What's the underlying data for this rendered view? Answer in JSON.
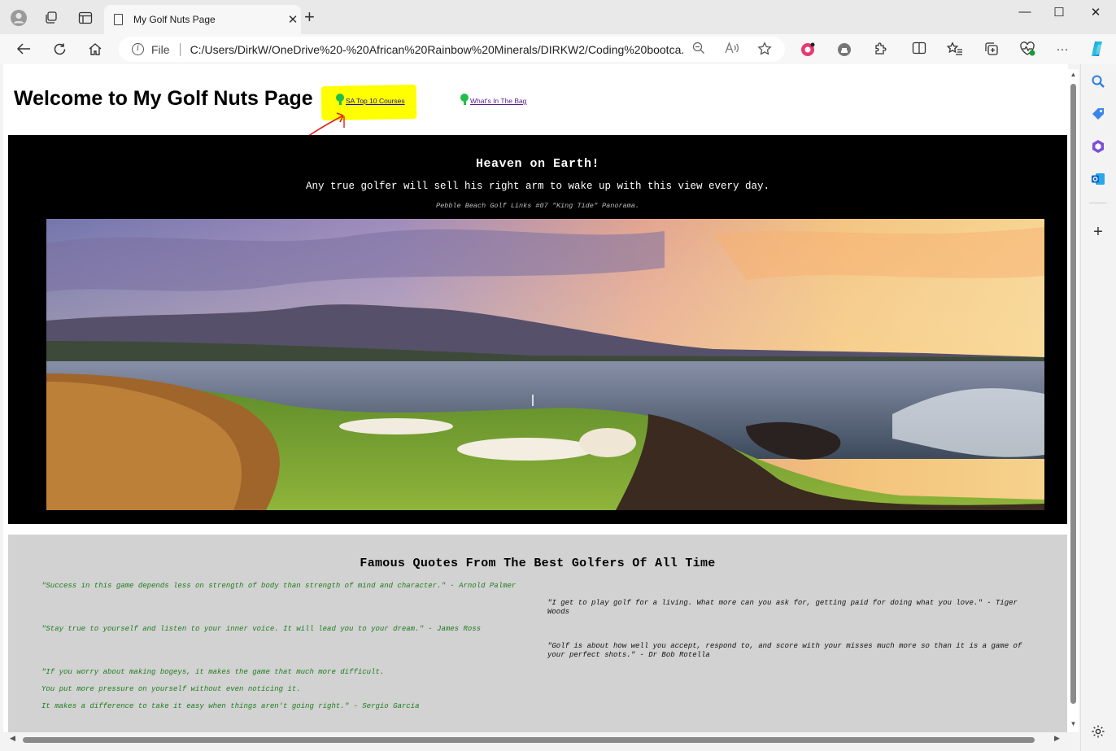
{
  "browser": {
    "tab_title": "My Golf Nuts Page",
    "address_label": "File",
    "url": "C:/Users/DirkW/OneDrive%20-%20African%20Rainbow%20Minerals/DIRKW2/Coding%20bootca...",
    "icons": [
      "profile-icon",
      "workspaces-icon",
      "tab-actions-icon",
      "page-icon",
      "close-icon",
      "new-tab-icon",
      "minimize-icon",
      "maximize-icon",
      "close-window-icon",
      "back-icon",
      "refresh-icon",
      "home-icon",
      "info-icon",
      "zoom-out-icon",
      "read-aloud-icon",
      "favorite-star-icon",
      "extension-icon",
      "split-screen-icon",
      "favorites-icon",
      "collections-icon",
      "browser-essentials-icon",
      "more-icon",
      "copilot-icon",
      "search-icon",
      "shopping-icon",
      "office-icon",
      "outlook-icon",
      "add-icon",
      "settings-icon"
    ]
  },
  "page": {
    "title": "Welcome to My Golf Nuts Page",
    "nav": [
      {
        "label": "SA Top 10 Courses",
        "color": "#1a0dab",
        "highlighted": true
      },
      {
        "label": "What's In The Bag",
        "color": "#551a8b",
        "highlighted": false
      }
    ],
    "hero": {
      "heading": "Heaven on Earth!",
      "subheading": "Any true golfer will sell his right arm to wake up with this view every day.",
      "caption": "Pebble Beach Golf Links #07 \"King Tide\" Panorama."
    },
    "quotes_section": {
      "heading": "Famous Quotes From The Best Golfers Of All Time",
      "left": [
        "\"Success in this game depends less on strength of body than strength of mind and character.\" - Arnold Palmer",
        "\"Stay true to yourself and listen to your inner voice. It will lead you to your dream.\" - James Ross",
        "\"If you worry about making bogeys, it makes the game that much more difficult.",
        "You put more pressure on yourself without even noticing it.",
        "It makes a difference to take it easy when things aren't going right.\" - Sergio Garcia"
      ],
      "right": [
        "\"I get to play golf for a living. What more can you ask for, getting paid for doing what you love.\" - Tiger Woods",
        "\"Golf is about how well you accept, respond to, and score with your misses much more so than it is a game of your perfect shots.\" - Dr Bob Rotella"
      ],
      "left_color": "#1e7c1e"
    },
    "colors": {
      "highlight": "#ffff00",
      "annotation_arrow": "#e02020",
      "tee_ball": "#1fbf4a"
    }
  }
}
